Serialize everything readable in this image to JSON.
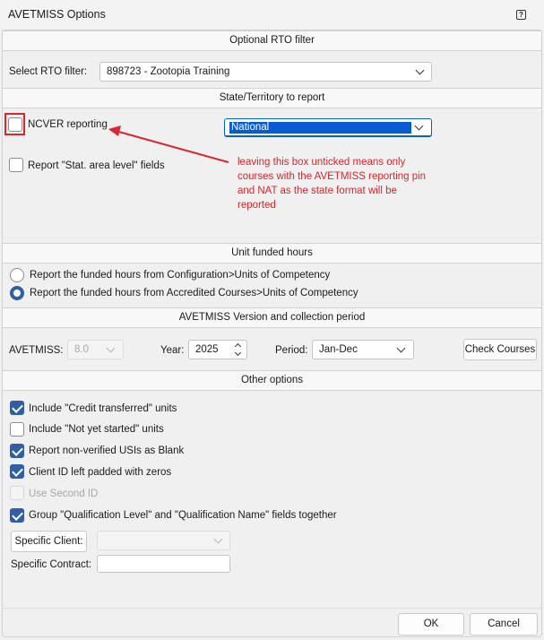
{
  "window": {
    "title": "AVETMISS Options",
    "help_icon": "?"
  },
  "rto_filter": {
    "header": "Optional RTO filter",
    "label": "Select RTO filter:",
    "value": "898723 - Zootopia Training"
  },
  "state": {
    "header": "State/Territory to report",
    "ncver_label": "NCVER reporting",
    "ncver_checked": false,
    "stat_area_label": "Report \"Stat. area level\" fields",
    "stat_area_checked": false,
    "state_value": "National",
    "annotation": "leaving this box unticked means only courses with the AVETMISS reporting pin and NAT as the state format will be reported",
    "annotation_color": "#d9262f",
    "highlight_color": "#d9262f"
  },
  "funded_hours": {
    "header": "Unit funded hours",
    "option_config": "Report the funded hours from Configuration>Units of Competency",
    "option_accredited": "Report the funded hours from Accredited Courses>Units of Competency",
    "selected": "accredited"
  },
  "version": {
    "header": "AVETMISS Version and collection period",
    "avetmiss_label": "AVETMISS:",
    "avetmiss_value": "8.0",
    "year_label": "Year:",
    "year_value": "2025",
    "period_label": "Period:",
    "period_value": "Jan-Dec",
    "check_courses_label": "Check Courses"
  },
  "other": {
    "header": "Other options",
    "credit_transferred": "Include \"Credit transferred\" units",
    "not_yet_started": "Include \"Not yet started\" units",
    "non_verified_usi": "Report non-verified USIs as Blank",
    "client_id_padded": "Client ID left padded with zeros",
    "use_second_id": "Use Second ID",
    "group_qualification": "Group \"Qualification Level\" and \"Qualification Name\" fields together",
    "specific_client_label": "Specific Client:",
    "specific_contract_label": "Specific Contract:"
  },
  "footer": {
    "ok_label": "OK",
    "cancel_label": "Cancel"
  },
  "colors": {
    "accent": "#2f5fa7",
    "selection": "#0a5bd1"
  }
}
